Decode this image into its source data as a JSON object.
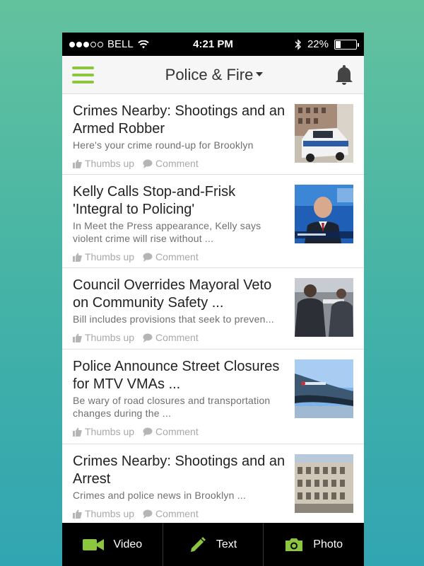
{
  "status_bar": {
    "carrier": "BELL",
    "time": "4:21 PM",
    "battery_percent": "22%",
    "battery_level": 0.22
  },
  "nav": {
    "title": "Police & Fire",
    "menu_icon": "hamburger-menu-icon",
    "notification_icon": "bell-icon"
  },
  "colors": {
    "accent": "#8cc63f",
    "tab_bar": "#000000"
  },
  "feed": {
    "action_thumbs": "Thumbs up",
    "action_comment": "Comment",
    "items": [
      {
        "title": "Crimes Nearby: Shootings and an Armed Robber",
        "summary": "Here's your crime round-up for Brooklyn"
      },
      {
        "title": "Kelly Calls Stop-and-Frisk 'Integral to Policing'",
        "summary": "In Meet the Press appearance, Kelly says violent crime will rise without ..."
      },
      {
        "title": "Council Overrides Mayoral Veto on Community Safety ...",
        "summary": "Bill includes provisions that seek to preven..."
      },
      {
        "title": "Police Announce Street Closures for MTV VMAs ...",
        "summary": "Be wary of road closures and transportation changes during the ..."
      },
      {
        "title": "Crimes Nearby: Shootings and an Arrest",
        "summary": "Crimes and police news in Brooklyn ..."
      }
    ]
  },
  "tab_bar": {
    "tabs": [
      {
        "label": "Video",
        "icon": "video-camera-icon"
      },
      {
        "label": "Text",
        "icon": "pencil-icon"
      },
      {
        "label": "Photo",
        "icon": "camera-icon"
      }
    ]
  }
}
